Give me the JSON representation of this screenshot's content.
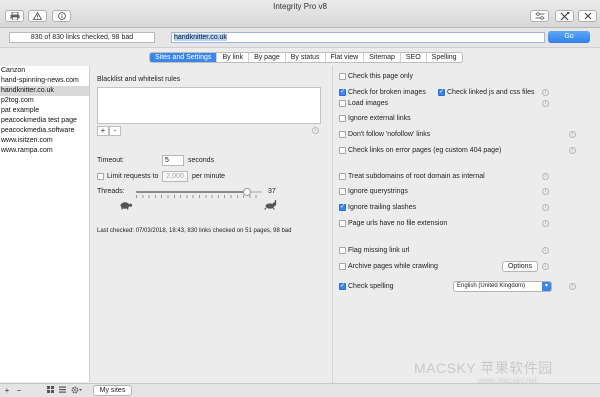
{
  "window": {
    "title": "Integrity Pro v8"
  },
  "toolbar": {
    "left_icons": [
      "printer-icon",
      "warning-icon",
      "info-icon"
    ],
    "right_icons": [
      "filter-icon",
      "settings-icon",
      "close-icon"
    ]
  },
  "status": {
    "text": "830 of 830 links checked, 98 bad"
  },
  "url": {
    "value": "handknitter.co.uk"
  },
  "go": {
    "label": "Go"
  },
  "tabs": [
    {
      "label": "Sites and Settings",
      "active": true
    },
    {
      "label": "By link"
    },
    {
      "label": "By page"
    },
    {
      "label": "By status"
    },
    {
      "label": "Flat view"
    },
    {
      "label": "Sitemap"
    },
    {
      "label": "SEO"
    },
    {
      "label": "Spelling"
    }
  ],
  "sidebar": {
    "sites": [
      {
        "label": "Canzon"
      },
      {
        "label": "hand-spinning-news.com"
      },
      {
        "label": "handknitter.co.uk",
        "selected": true
      },
      {
        "label": "p2tog.com"
      },
      {
        "label": "pat example"
      },
      {
        "label": "peacockmedia test page"
      },
      {
        "label": "peacockmedia.software"
      },
      {
        "label": "www.isitzen.com"
      },
      {
        "label": "www.rampa.com"
      }
    ],
    "my_sites_label": "My sites"
  },
  "left_panel": {
    "rules_label": "Blacklist and whitelist rules",
    "add_label": "+",
    "remove_label": "-",
    "timeout_label": "Timeout:",
    "timeout_value": "5",
    "timeout_unit": "seconds",
    "limit_label": "Limit requests to",
    "limit_value": "2,000",
    "limit_unit": "per minute",
    "threads_label": "Threads:",
    "threads_value": "37",
    "threads_fraction": 0.88,
    "last_checked": "Last checked: 07/03/2018, 18:43, 830 links checked on 51 pages, 98 bad"
  },
  "options": [
    {
      "label": "Check this page only",
      "checked": false,
      "info": false
    },
    {
      "label": "Check for broken images",
      "checked": true,
      "info": false
    },
    {
      "label": "Check linked js and css files",
      "checked": true,
      "info": true
    },
    {
      "label": "Load images",
      "checked": false,
      "info": true
    },
    {
      "label": "Ignore external links",
      "checked": false,
      "info": false
    },
    {
      "label": "Don't follow 'nofollow' links",
      "checked": false,
      "info": true
    },
    {
      "label": "Check links on error pages (eg custom 404 page)",
      "checked": false,
      "info": true
    },
    {
      "label": "Treat subdomains of root domain as internal",
      "checked": false,
      "info": true
    },
    {
      "label": "Ignore querystrings",
      "checked": false,
      "info": true
    },
    {
      "label": "Ignore trailing slashes",
      "checked": true,
      "info": true
    },
    {
      "label": "Page urls have no file extension",
      "checked": false,
      "info": true
    },
    {
      "label": "Flag missing link url",
      "checked": false,
      "info": true
    },
    {
      "label": "Archive pages while crawling",
      "checked": false,
      "info": true
    },
    {
      "label": "Check spelling",
      "checked": true,
      "info": true
    }
  ],
  "options_button": "Options",
  "language": "English (United Kingdom)",
  "watermark": {
    "text": "MACSKY 苹果软件园",
    "url": "www.macsky.net"
  },
  "colors": {
    "accent": "#3b86ea"
  }
}
